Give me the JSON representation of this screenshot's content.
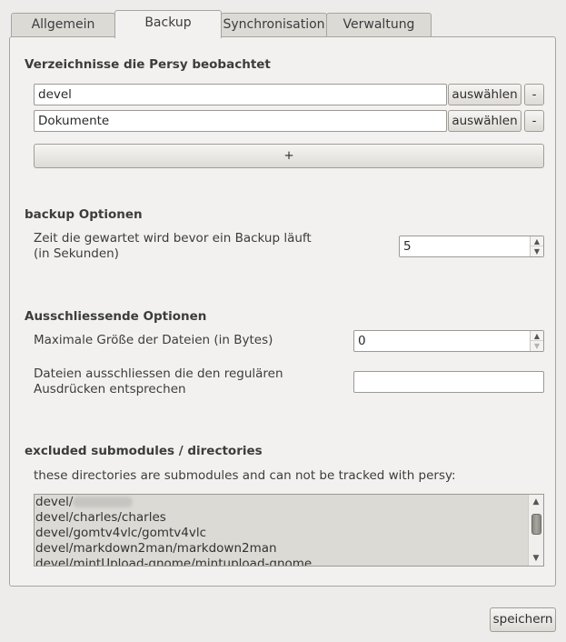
{
  "tabs": [
    {
      "label": "Allgemein",
      "active": false
    },
    {
      "label": "Backup",
      "active": true
    },
    {
      "label": "Synchronisation",
      "active": false
    },
    {
      "label": "Verwaltung",
      "active": false
    }
  ],
  "watched": {
    "title": "Verzeichnisse die Persy beobachtet",
    "rows": [
      {
        "value": "devel",
        "choose_label": "auswählen",
        "remove_label": "-"
      },
      {
        "value": "Dokumente",
        "choose_label": "auswählen",
        "remove_label": "-"
      }
    ],
    "add_label": "+"
  },
  "backup": {
    "title": "backup Optionen",
    "wait_label_line1": "Zeit die gewartet wird bevor ein Backup läuft",
    "wait_label_line2": "(in Sekunden)",
    "wait_value": "5"
  },
  "exclude": {
    "title": "Ausschliessende Optionen",
    "max_size_label": "Maximale Größe der Dateien (in Bytes)",
    "max_size_value": "0",
    "regex_label_line1": "Dateien ausschliessen die den regulären",
    "regex_label_line2": "Ausdrücken entsprechen",
    "regex_value": ""
  },
  "submodules": {
    "title": "excluded submodules / directories",
    "description": "these directories are submodules and can not be tracked with persy:",
    "items": [
      "devel/",
      "devel/charles/charles",
      "devel/gomtv4vlc/gomtv4vlc",
      "devel/markdown2man/markdown2man",
      "devel/mintUpload-gnome/mintupload-gnome"
    ]
  },
  "save_label": "speichern",
  "icons": {
    "spin_up": "chevron-up-icon",
    "spin_down": "chevron-down-icon",
    "scroll_up": "chevron-up-icon",
    "scroll_down": "chevron-down-icon"
  }
}
